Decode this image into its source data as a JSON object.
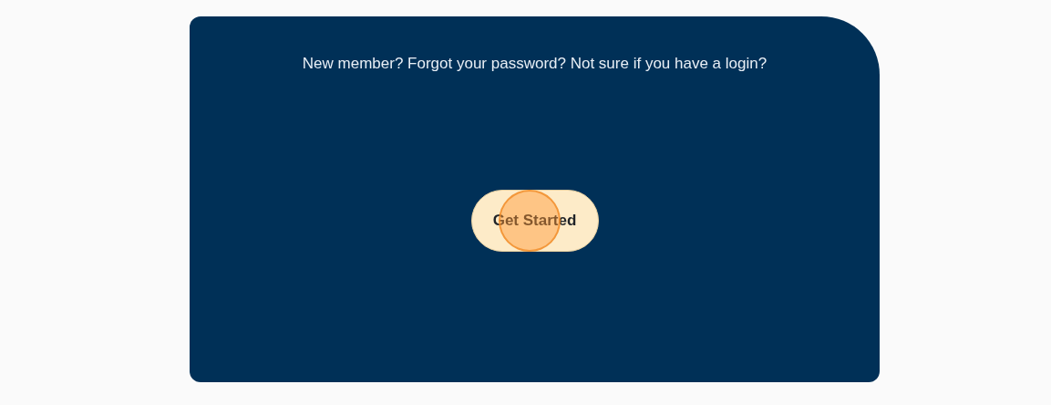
{
  "card": {
    "message": "New member? Forgot your password? Not sure if you have a login?",
    "button": {
      "label": "Get Started"
    },
    "click_marker": true
  }
}
